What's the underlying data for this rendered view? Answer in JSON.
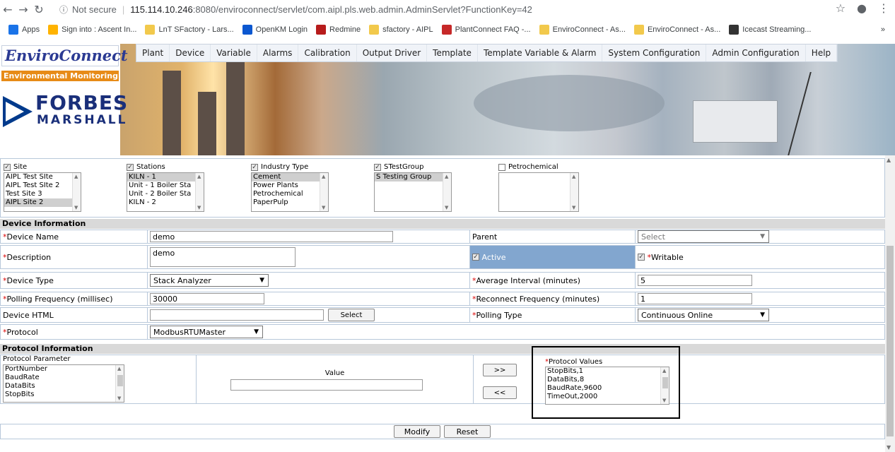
{
  "browser": {
    "security": "Not secure",
    "host": "115.114.10.246",
    "url_rest": ":8080/enviroconnect/servlet/com.aipl.pls.web.admin.AdminServlet?FunctionKey=42",
    "bookmarks": [
      {
        "label": "Apps",
        "color": "#1a73e8"
      },
      {
        "label": "Sign into : Ascent In...",
        "color": "#ffb300"
      },
      {
        "label": "LnT SFactory - Lars...",
        "color": "#f2c94c"
      },
      {
        "label": "OpenKM Login",
        "color": "#0b57d0"
      },
      {
        "label": "Redmine",
        "color": "#b71c1c"
      },
      {
        "label": "sfactory - AIPL",
        "color": "#f2c94c"
      },
      {
        "label": "PlantConnect FAQ -...",
        "color": "#c62828"
      },
      {
        "label": "EnviroConnect - As...",
        "color": "#f2c94c"
      },
      {
        "label": "EnviroConnect - As...",
        "color": "#f2c94c"
      },
      {
        "label": "Icecast Streaming...",
        "color": "#333333"
      }
    ],
    "more": "»"
  },
  "header": {
    "logo_main": "EnviroConnect",
    "logo_sub": "Environmental Monitoring",
    "company_top": "FORBES",
    "company_bottom": "MARSHALL",
    "menu": [
      "Plant",
      "Device",
      "Variable",
      "Alarms",
      "Calibration",
      "Output Driver",
      "Template",
      "Template Variable & Alarm",
      "System Configuration",
      "Admin Configuration",
      "Help"
    ]
  },
  "filters": [
    {
      "label": "Site",
      "checked": true,
      "options": [
        "AIPL Test SIte",
        "AIPL Test SIte 2",
        "Test Site 3",
        "AIPL Site 2"
      ],
      "selected": [
        3
      ]
    },
    {
      "label": "Stations",
      "checked": true,
      "options": [
        "KILN - 1",
        "Unit - 1 Boiler Sta",
        "Unit - 2 Boiler Sta",
        "KILN - 2"
      ],
      "selected": [
        0
      ]
    },
    {
      "label": "Industry Type",
      "checked": true,
      "options": [
        "Cement",
        "Power Plants",
        "Petrochemical",
        "PaperPulp"
      ],
      "selected": [
        0
      ]
    },
    {
      "label": "STestGroup",
      "checked": true,
      "options": [
        "S Testing Group"
      ],
      "selected": [
        0
      ]
    },
    {
      "label": "Petrochemical",
      "checked": false,
      "options": [],
      "selected": []
    }
  ],
  "device": {
    "section": "Device Information",
    "name_label": "Device Name",
    "name_value": "demo",
    "parent_label": "Parent",
    "parent_value": "Select",
    "desc_label": "Description",
    "desc_value": "demo",
    "active_label": "Active",
    "writable_label": "Writable",
    "type_label": " Device Type",
    "type_value": "Stack Analyzer",
    "avg_label": "Average Interval (minutes)",
    "avg_value": "5",
    "poll_label": "Polling Frequency (millisec)",
    "poll_value": "30000",
    "reconnect_label": "Reconnect Frequency (minutes)",
    "reconnect_value": "1",
    "html_label": "Device HTML",
    "html_value": "",
    "select_btn": "Select",
    "polltype_label": "Polling Type",
    "polltype_value": "Continuous Online",
    "protocol_label": "Protocol",
    "protocol_value": "ModbusRTUMaster",
    "star": "*"
  },
  "protocol": {
    "section": "Protocol Information",
    "param_label": "Protocol Parameter",
    "params": [
      "PortNumber",
      "BaudRate",
      "DataBits",
      "StopBits"
    ],
    "value_label": "Value",
    "add_btn": ">>",
    "remove_btn": "<<",
    "values_label": "Protocol Values",
    "values": [
      "StopBits,1",
      "DataBits,8",
      "BaudRate,9600",
      "TimeOut,2000"
    ]
  },
  "actions": {
    "modify": "Modify",
    "reset": "Reset"
  }
}
